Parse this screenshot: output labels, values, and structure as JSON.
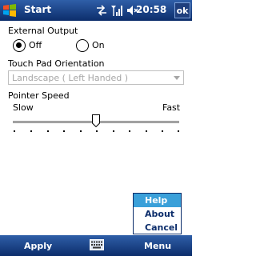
{
  "titlebar": {
    "title": "Start",
    "time": "20:58",
    "ok_label": "ok",
    "icons": [
      "windows-logo-icon",
      "sync-arrows-icon",
      "signal-icon",
      "speaker-mute-icon"
    ]
  },
  "external_output": {
    "label": "External Output",
    "options": [
      {
        "label": "Off",
        "selected": true
      },
      {
        "label": "On",
        "selected": false
      }
    ]
  },
  "touch_pad": {
    "label": "Touch Pad Orientation",
    "value": "Landscape ( Left Handed )",
    "disabled": true
  },
  "pointer_speed": {
    "label": "Pointer Speed",
    "min_label": "Slow",
    "max_label": "Fast",
    "value_fraction": 0.5,
    "tick_count": 11
  },
  "menu": {
    "items": [
      {
        "label": "Help",
        "selected": true
      },
      {
        "label": "About",
        "selected": false
      },
      {
        "label": "Cancel",
        "selected": false
      }
    ]
  },
  "softkeys": {
    "left": "Apply",
    "right": "Menu"
  },
  "colors": {
    "bar_dark": "#0c2d6b",
    "bar_light": "#2f5fa8",
    "menu_highlight": "#3aa0d9"
  }
}
